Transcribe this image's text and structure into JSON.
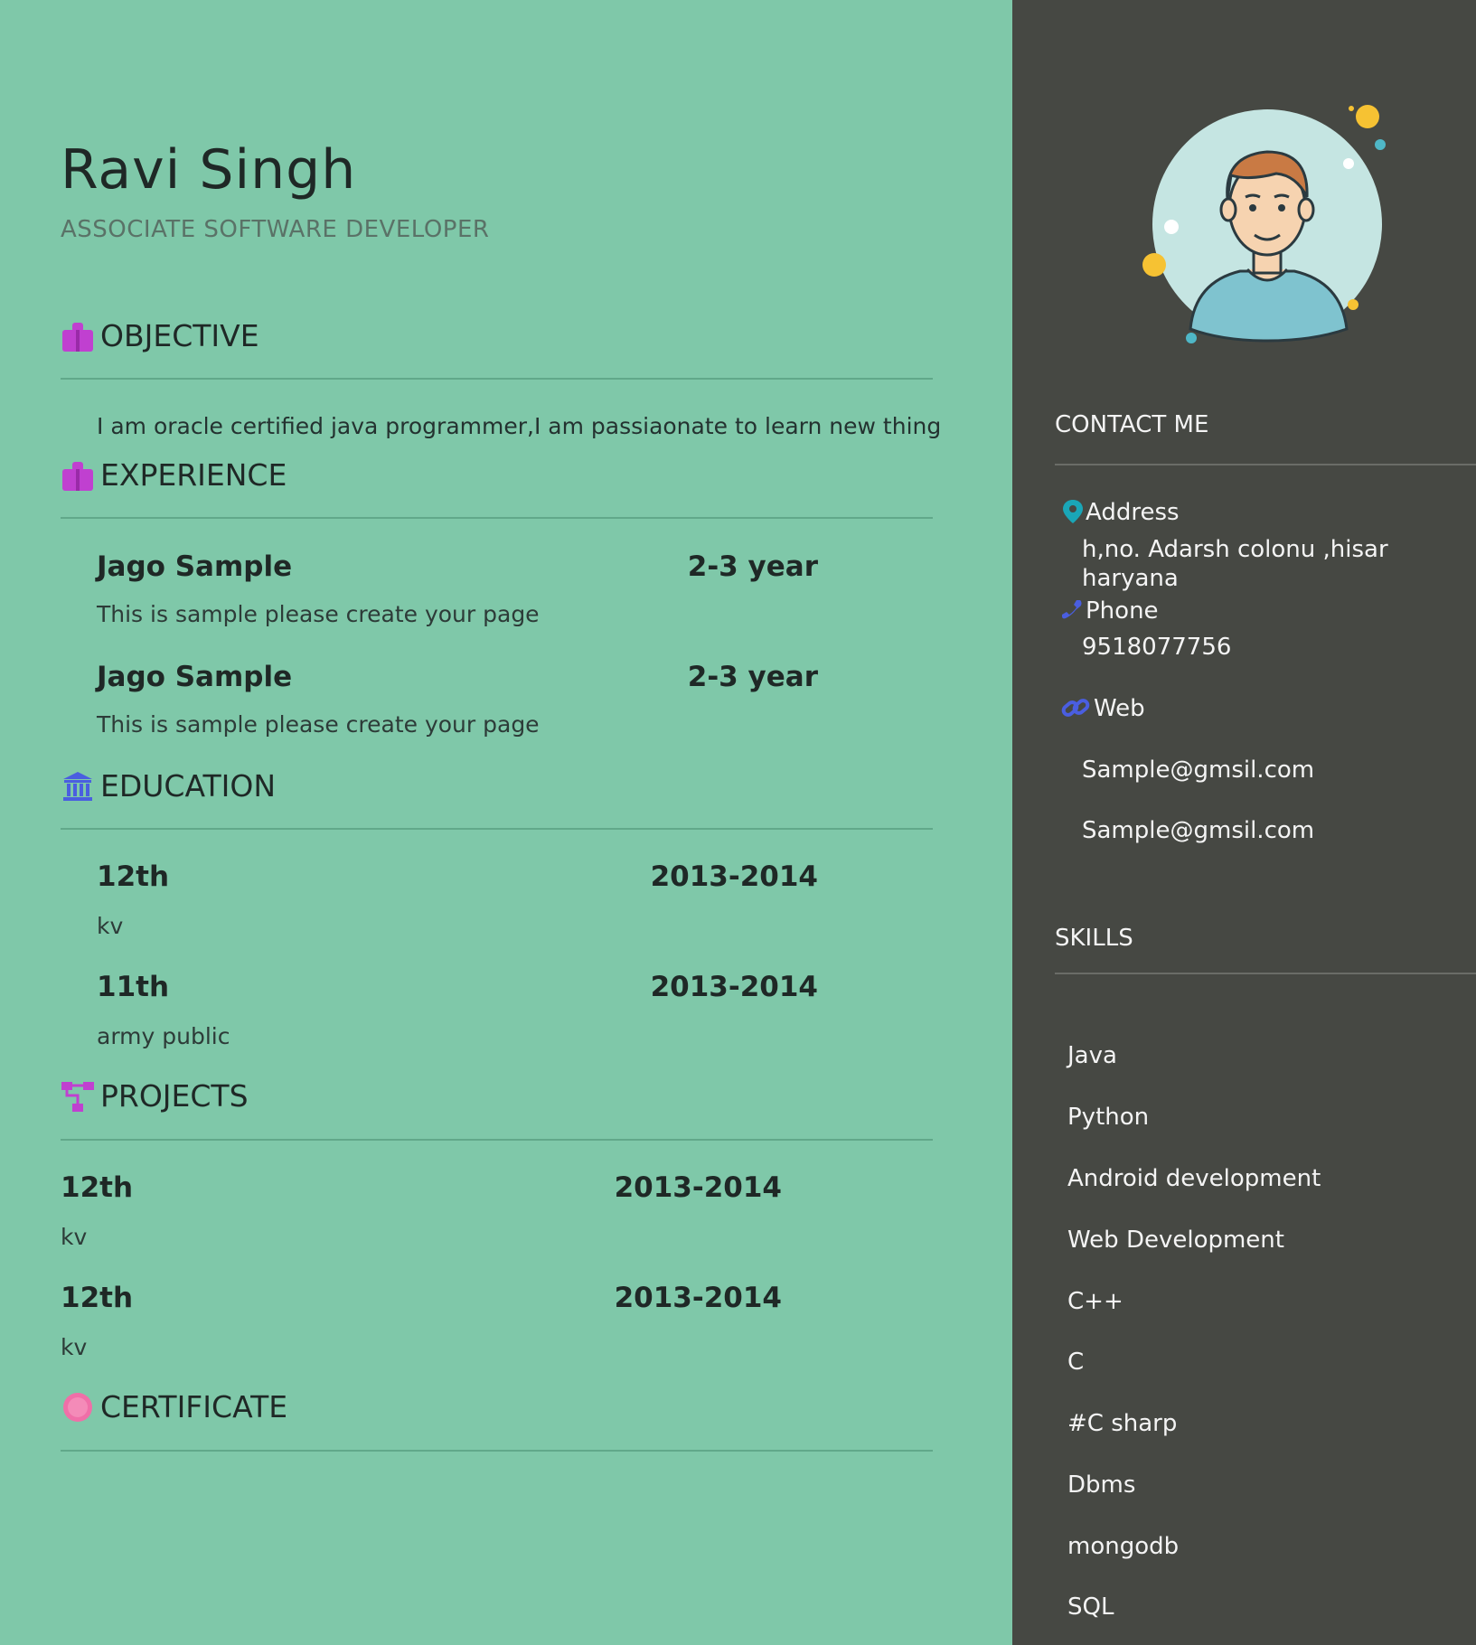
{
  "header": {
    "name": "Ravi Singh",
    "title": "ASSOCIATE SOFTWARE DEVELOPER"
  },
  "sections": {
    "objective": {
      "label": "OBJECTIVE",
      "icon": "briefcase-icon",
      "text": "I am oracle certified java programmer,I am passiaonate to learn new thing"
    },
    "experience": {
      "label": "EXPERIENCE",
      "icon": "briefcase-icon",
      "items": [
        {
          "title": "Jago Sample",
          "date": "2-3 year",
          "desc": "This is sample please create your page"
        },
        {
          "title": "Jago Sample",
          "date": "2-3 year",
          "desc": "This is sample please create your page"
        }
      ]
    },
    "education": {
      "label": "EDUCATION",
      "icon": "institution-icon",
      "items": [
        {
          "title": "12th",
          "date": "2013-2014",
          "desc": "kv"
        },
        {
          "title": "11th",
          "date": "2013-2014",
          "desc": "army public"
        }
      ]
    },
    "projects": {
      "label": "PROJECTS",
      "icon": "sitemap-icon",
      "items": [
        {
          "title": "12th",
          "date": "2013-2014",
          "desc": "kv"
        },
        {
          "title": "12th",
          "date": "2013-2014",
          "desc": "kv"
        }
      ]
    },
    "certificate": {
      "label": "CERTIFICATE",
      "icon": "badge-icon"
    }
  },
  "sidebar": {
    "contact": {
      "heading": "CONTACT ME",
      "address_label": "Address",
      "address_value": "h,no. Adarsh colonu ,hisar haryana",
      "phone_label": "Phone",
      "phone_value": "9518077756",
      "web_label": "Web",
      "web_values": [
        "Sample@gmsil.com",
        "Sample@gmsil.com"
      ]
    },
    "skills": {
      "heading": "SKILLS",
      "items": [
        "Java",
        "Python",
        "Android development",
        "Web Development",
        "C++",
        "C",
        "#C sharp",
        "Dbms",
        "mongodb",
        "SQL"
      ]
    }
  },
  "colors": {
    "left_background": "#7fc8a9",
    "right_background": "#464843",
    "icon_purple": "#c040d0",
    "icon_blue": "#4a5ee0",
    "icon_teal": "#1aa6b7",
    "icon_pink": "#f06fa8"
  }
}
